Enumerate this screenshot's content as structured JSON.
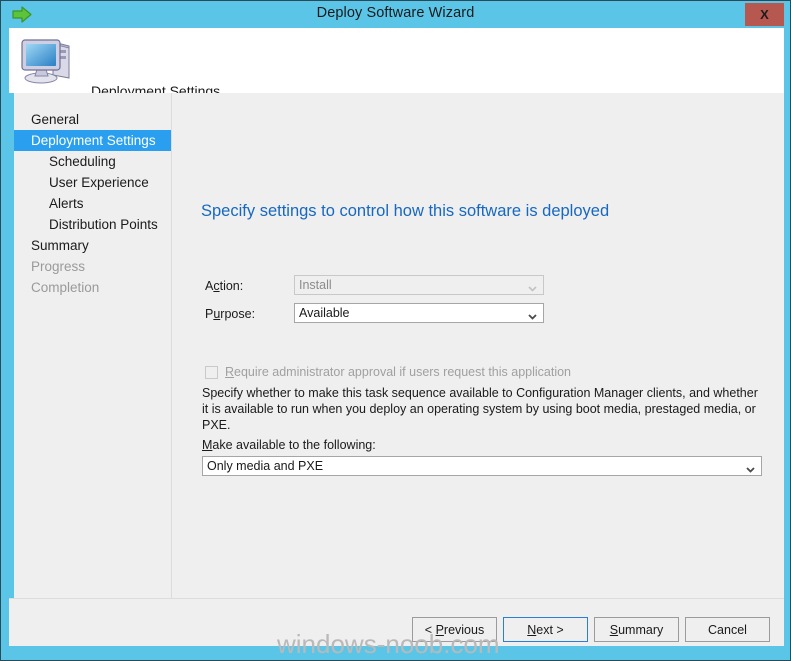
{
  "window": {
    "title": "Deploy Software Wizard",
    "close_label": "X",
    "title_icon": "green-arrow-icon",
    "accent_color": "#5bc5e8",
    "frame_border_color": "#2b4a57",
    "close_button_color": "#b6584f"
  },
  "header": {
    "title": "Deployment Settings",
    "icon": "computer-icon"
  },
  "sidebar": {
    "items": [
      {
        "label": "General",
        "indent": false,
        "state": "normal"
      },
      {
        "label": "Deployment Settings",
        "indent": false,
        "state": "selected"
      },
      {
        "label": "Scheduling",
        "indent": true,
        "state": "normal"
      },
      {
        "label": "User Experience",
        "indent": true,
        "state": "normal"
      },
      {
        "label": "Alerts",
        "indent": true,
        "state": "normal"
      },
      {
        "label": "Distribution Points",
        "indent": true,
        "state": "normal"
      },
      {
        "label": "Summary",
        "indent": false,
        "state": "normal"
      },
      {
        "label": "Progress",
        "indent": false,
        "state": "disabled"
      },
      {
        "label": "Completion",
        "indent": false,
        "state": "disabled"
      }
    ],
    "selected_color": "#2a9ff0"
  },
  "content": {
    "heading": "Specify settings to control how this software is deployed",
    "heading_color": "#1668c1",
    "action": {
      "label_pre": "A",
      "label_key": "c",
      "label_post": "tion:",
      "value": "Install",
      "enabled": false,
      "chevron": "chevron-down-icon"
    },
    "purpose": {
      "label_pre": "P",
      "label_key": "u",
      "label_post": "rpose:",
      "value": "Available",
      "enabled": true,
      "chevron": "chevron-down-icon"
    },
    "approval": {
      "checked": false,
      "enabled": false,
      "label_key": "R",
      "label_rest": "equire administrator approval if users request this application"
    },
    "description": "Specify whether to make this task sequence available to Configuration Manager clients, and whether it is available to run when you deploy an operating system by using boot media, prestaged media, or PXE.",
    "make_available": {
      "label_key": "M",
      "label_rest": "ake available to the following:",
      "value": "Only media and PXE",
      "enabled": true,
      "chevron": "chevron-down-icon"
    }
  },
  "footer": {
    "buttons": [
      {
        "pre": "< ",
        "key": "P",
        "post": "revious",
        "default": false
      },
      {
        "pre": "",
        "key": "N",
        "post": "ext >",
        "default": true
      },
      {
        "pre": "",
        "key": "S",
        "post": "ummary",
        "default": false
      },
      {
        "pre": "",
        "key": "",
        "post": "Cancel",
        "default": false
      }
    ]
  },
  "watermark": {
    "text": "windows-noob.com"
  }
}
